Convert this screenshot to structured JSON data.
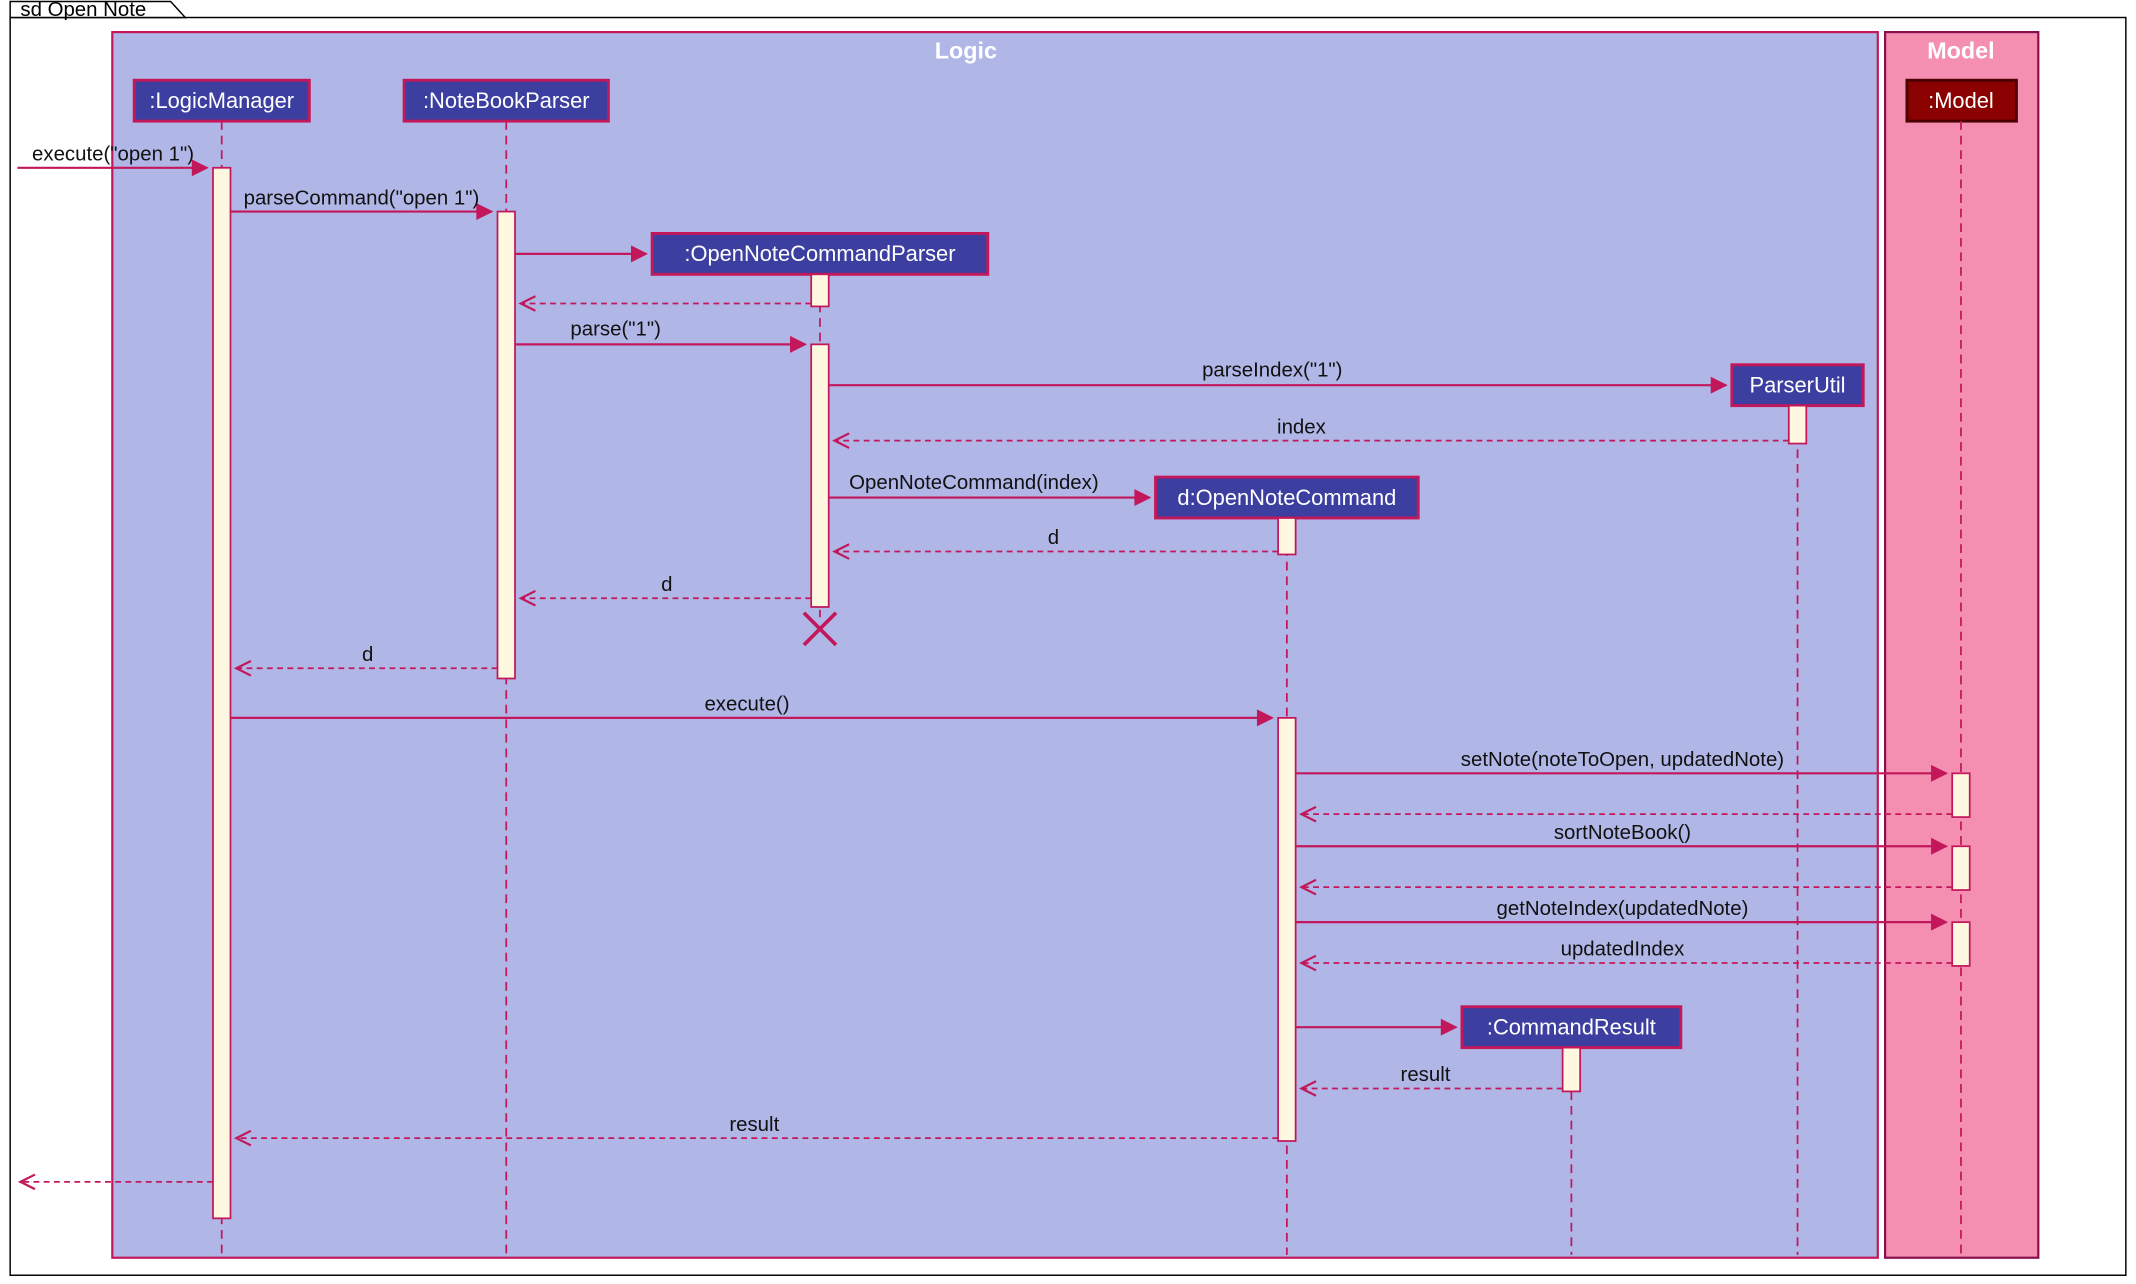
{
  "diagram_title": "sd Open Note",
  "frames": {
    "logic": "Logic",
    "model": "Model"
  },
  "participants": {
    "logicManager": ":LogicManager",
    "notebookParser": ":NoteBookParser",
    "openNoteCommandParser": ":OpenNoteCommandParser",
    "parserUtil": "ParserUtil",
    "openNoteCommand": "d:OpenNoteCommand",
    "commandResult": ":CommandResult",
    "model": ":Model"
  },
  "messages": {
    "m1": "execute(\"open 1\")",
    "m2": "parseCommand(\"open 1\")",
    "m3": "parse(\"1\")",
    "m4": "parseIndex(\"1\")",
    "m5": "index",
    "m6": "OpenNoteCommand(index)",
    "m7": "d",
    "m8": "d",
    "m9": "d",
    "m10": "execute()",
    "m11": "setNote(noteToOpen, updatedNote)",
    "m12": "sortNoteBook()",
    "m13": "getNoteIndex(updatedNote)",
    "m14": "updatedIndex",
    "m15": "result",
    "m16": "result"
  }
}
